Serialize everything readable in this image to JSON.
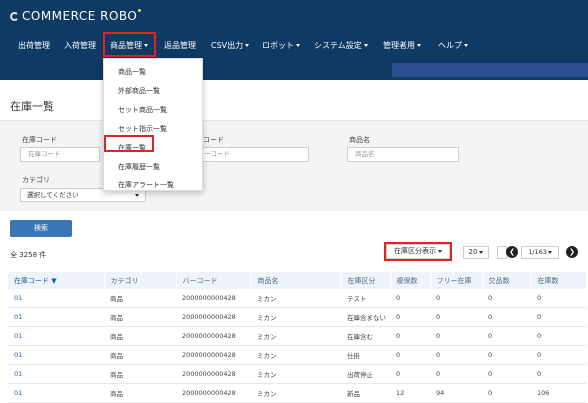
{
  "header": {
    "logo_text": "COMMERCE ROBO",
    "nav": [
      {
        "label": "出荷管理",
        "dropdown": false
      },
      {
        "label": "入荷管理",
        "dropdown": false
      },
      {
        "label": "商品管理",
        "dropdown": true
      },
      {
        "label": "返品管理",
        "dropdown": false
      },
      {
        "label": "CSV出力",
        "dropdown": true
      },
      {
        "label": "ロボット",
        "dropdown": true
      },
      {
        "label": "システム設定",
        "dropdown": true
      },
      {
        "label": "管理者用",
        "dropdown": true
      },
      {
        "label": "ヘルプ",
        "dropdown": true
      }
    ]
  },
  "product_menu": {
    "items": [
      "商品一覧",
      "外部商品一覧",
      "セット商品一覧",
      "セット指示一覧",
      "在庫一覧",
      "在庫履歴一覧",
      "在庫アラート一覧"
    ],
    "highlighted_index": 4
  },
  "page": {
    "title": "在庫一覧"
  },
  "search": {
    "code_label": "在庫コード",
    "code_placeholder": "在庫コード",
    "barcode_label_partial": "コード",
    "barcode_placeholder_partial": "ーコード",
    "name_label": "商品名",
    "name_placeholder": "商品名",
    "category_label": "カテゴリ",
    "category_value": "選択してください",
    "search_button": "検索"
  },
  "results": {
    "total": "全 3258 件",
    "view_button": "在庫区分表示",
    "per_page": "20",
    "prev": "❮",
    "next": "❯",
    "page_indicator": "1/163"
  },
  "table": {
    "headers": [
      "在庫コード ▼",
      "カテゴリ",
      "バーコード",
      "商品名",
      "在庫区分",
      "複保数",
      "フリー在庫",
      "欠品数",
      "在庫数"
    ],
    "rows": [
      [
        "01",
        "商品",
        "2000000000428",
        "ミカン",
        "テスト",
        "0",
        "0",
        "0",
        "0"
      ],
      [
        "01",
        "商品",
        "2000000000428",
        "ミカン",
        "在庫含まない",
        "0",
        "0",
        "0",
        "0"
      ],
      [
        "01",
        "商品",
        "2000000000428",
        "ミカン",
        "在庫含む",
        "0",
        "0",
        "0",
        "0"
      ],
      [
        "01",
        "商品",
        "2000000000428",
        "ミカン",
        "仕掛",
        "0",
        "0",
        "0",
        "0"
      ],
      [
        "01",
        "商品",
        "2000000000428",
        "ミカン",
        "出荷停止",
        "0",
        "0",
        "0",
        "0"
      ],
      [
        "01",
        "商品",
        "2000000000428",
        "ミカン",
        "新品",
        "12",
        "94",
        "0",
        "106"
      ]
    ]
  },
  "colors": {
    "header_bg": "#0e3a63",
    "highlight": "#e02424",
    "button_primary": "#3a75b5",
    "link": "#1f5fa8"
  }
}
